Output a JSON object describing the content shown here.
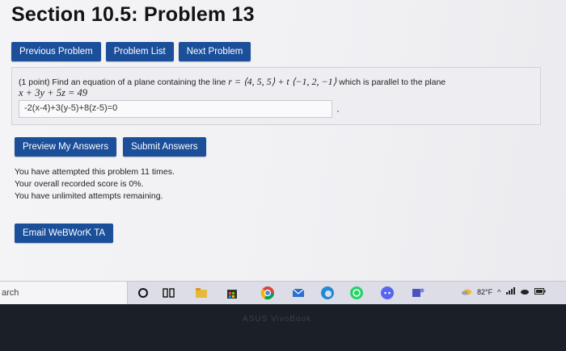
{
  "page": {
    "title": "Section 10.5: Problem 13"
  },
  "nav": {
    "previous": "Previous Problem",
    "list": "Problem List",
    "next": "Next Problem"
  },
  "problem": {
    "intro": "(1 point) Find an equation of a plane containing the line ",
    "line_eq": "r = ⟨4, 5, 5⟩ + t ⟨−1, 2, −1⟩",
    "tail": " which is parallel to the plane",
    "plane_eq": "x + 3y + 5z = 49",
    "answer_value": "-2(x-4)+3(y-5)+8(z-5)=0"
  },
  "actions": {
    "preview": "Preview My Answers",
    "submit": "Submit Answers"
  },
  "messages": {
    "attempts": "You have attempted this problem 11 times.",
    "score": "Your overall recorded score is 0%.",
    "remaining": "You have unlimited attempts remaining."
  },
  "email": {
    "label": "Email WeBWorK TA"
  },
  "taskbar": {
    "search_text": "arch",
    "temperature": "82°F",
    "bezel_brand": "ASUS VivoBook",
    "accent": "#1b4f9a"
  }
}
